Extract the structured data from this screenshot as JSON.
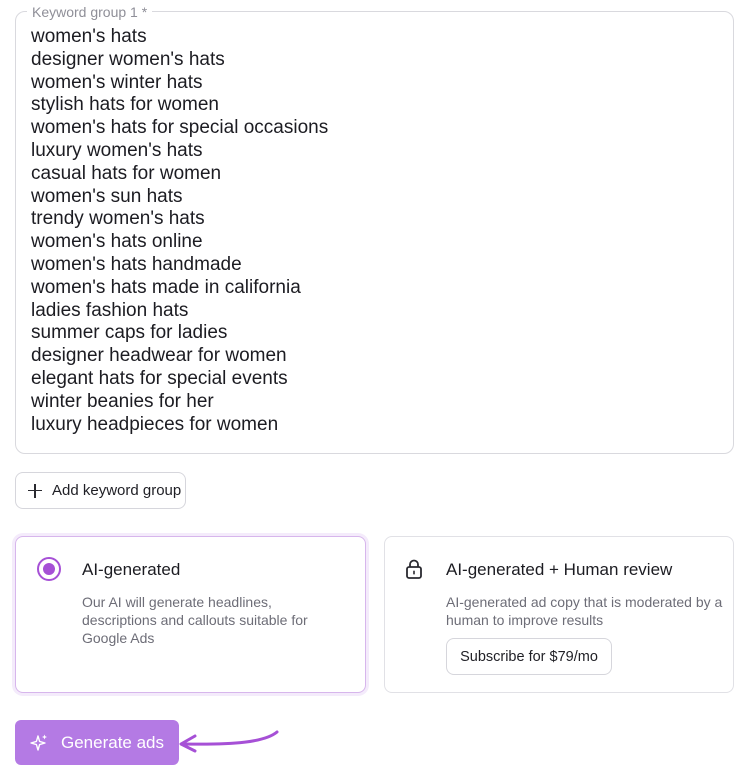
{
  "keyword_group": {
    "legend": "Keyword group 1 *",
    "keywords": [
      "women's hats",
      "designer women's hats",
      "women's winter hats",
      "stylish hats for women",
      "women's hats for special occasions",
      "luxury women's hats",
      "casual hats for women",
      "women's sun hats",
      "trendy women's hats",
      "women's hats online",
      "women's hats handmade",
      "women's hats made in california",
      "ladies fashion hats",
      "summer caps for ladies",
      "designer headwear for women",
      "elegant hats for special events",
      "winter beanies for her",
      "luxury headpieces for women"
    ]
  },
  "add_group": {
    "label": "Add keyword group",
    "icon": "plus-icon"
  },
  "options": {
    "ai": {
      "title": "AI-generated",
      "description": "Our AI will generate headlines, descriptions and callouts suitable for Google Ads",
      "selected": true
    },
    "human": {
      "title": "AI-generated + Human review",
      "description": "AI-generated ad copy that is moderated by a human to improve results",
      "subscribe_label": "Subscribe for $79/mo",
      "icon": "lock-icon"
    }
  },
  "generate": {
    "label": "Generate ads",
    "icon": "sparkle-icon"
  },
  "colors": {
    "accent": "#a650d6",
    "button": "#b47ae4",
    "border": "#d9d9de"
  }
}
